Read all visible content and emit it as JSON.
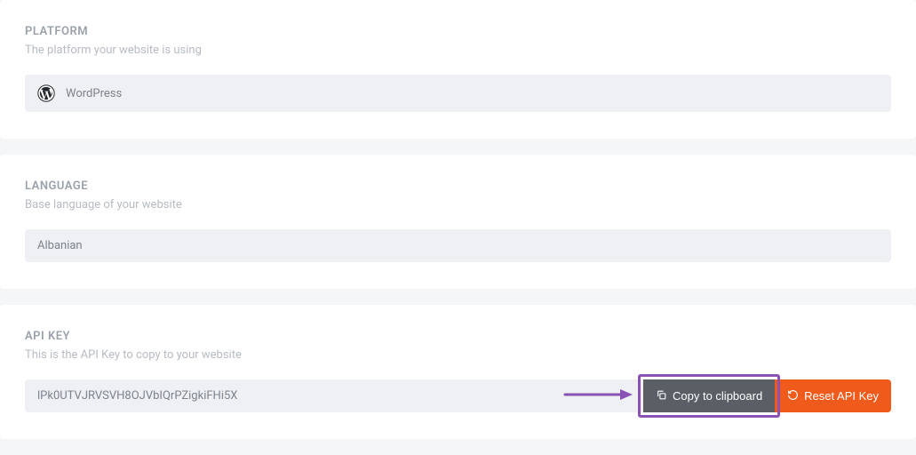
{
  "platform": {
    "title": "PLATFORM",
    "description": "The platform your website is using",
    "value": "WordPress",
    "icon": "wordpress-icon"
  },
  "language": {
    "title": "LANGUAGE",
    "description": "Base language of your website",
    "value": "Albanian"
  },
  "api": {
    "title": "API KEY",
    "description": "This is the API Key to copy to your website",
    "value": "lPk0UTVJRVSVH8OJVbIQrPZigkiFHi5X",
    "copy_label": "Copy to clipboard",
    "reset_label": "Reset API Key"
  },
  "colors": {
    "accent": "#f05a1a",
    "annotation": "#8a52b5",
    "field_bg": "#eef0f3",
    "button_dark": "#5a5f66"
  }
}
